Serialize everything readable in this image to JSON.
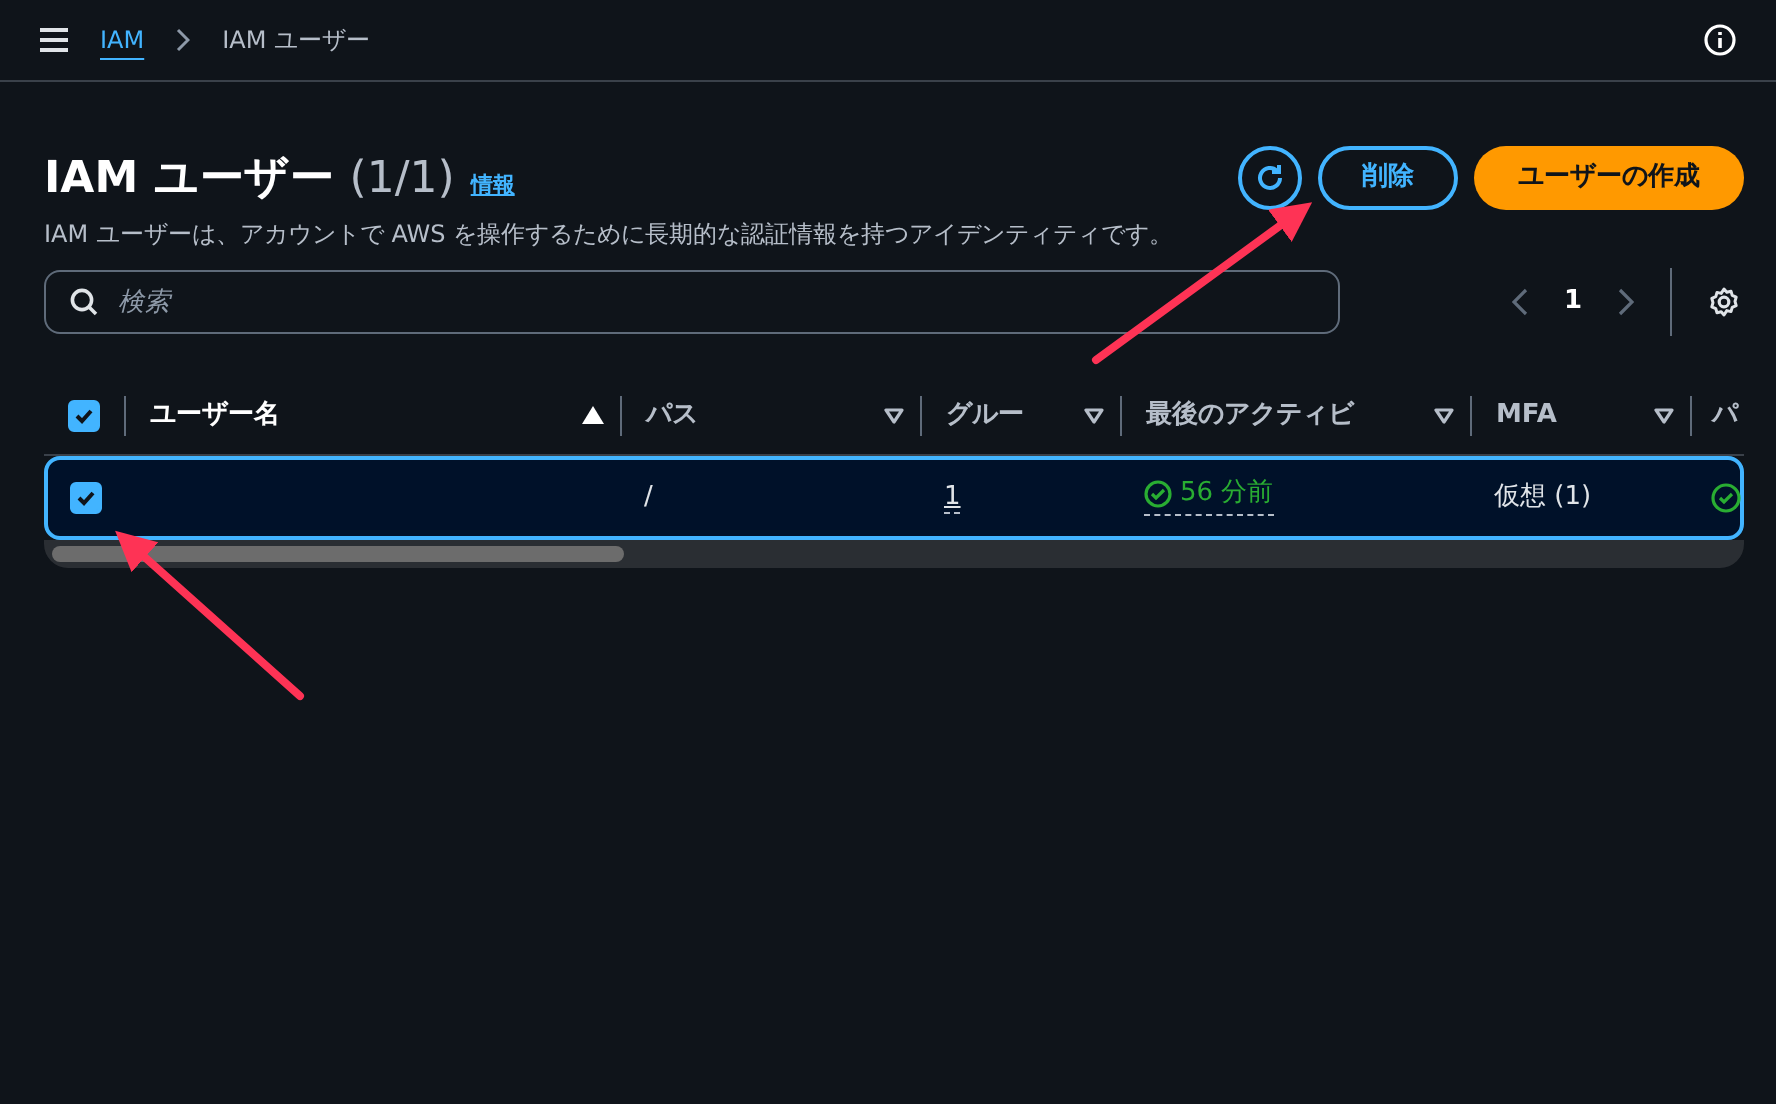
{
  "breadcrumb": [
    {
      "label": "IAM",
      "link": true
    },
    {
      "label": "IAM ユーザー",
      "link": false
    }
  ],
  "header": {
    "title": "IAM ユーザー",
    "count": "(1/1)",
    "info": "情報",
    "description": "IAM ユーザーは、アカウントで AWS を操作するために長期的な認証情報を持つアイデンティティです。"
  },
  "buttons": [
    {
      "kind": "refresh"
    },
    {
      "kind": "outline",
      "label": "削除"
    },
    {
      "kind": "primary",
      "label": "ユーザーの作成"
    }
  ],
  "search": {
    "placeholder": "検索"
  },
  "pagination": {
    "page": "1"
  },
  "table": {
    "all_selected": true,
    "columns": [
      {
        "label": "ユーザー名",
        "sorted": true
      },
      {
        "label": "パス",
        "sorted": false
      },
      {
        "label": "グルー",
        "sorted": false
      },
      {
        "label": "最後のアクティビ",
        "sorted": false
      },
      {
        "label": "MFA",
        "sorted": false
      },
      {
        "label": "パ"
      }
    ],
    "rows": [
      {
        "selected": true,
        "path": "/",
        "groups": "1",
        "last_activity": "56 分前",
        "mfa": "仮想 (1)"
      }
    ]
  }
}
